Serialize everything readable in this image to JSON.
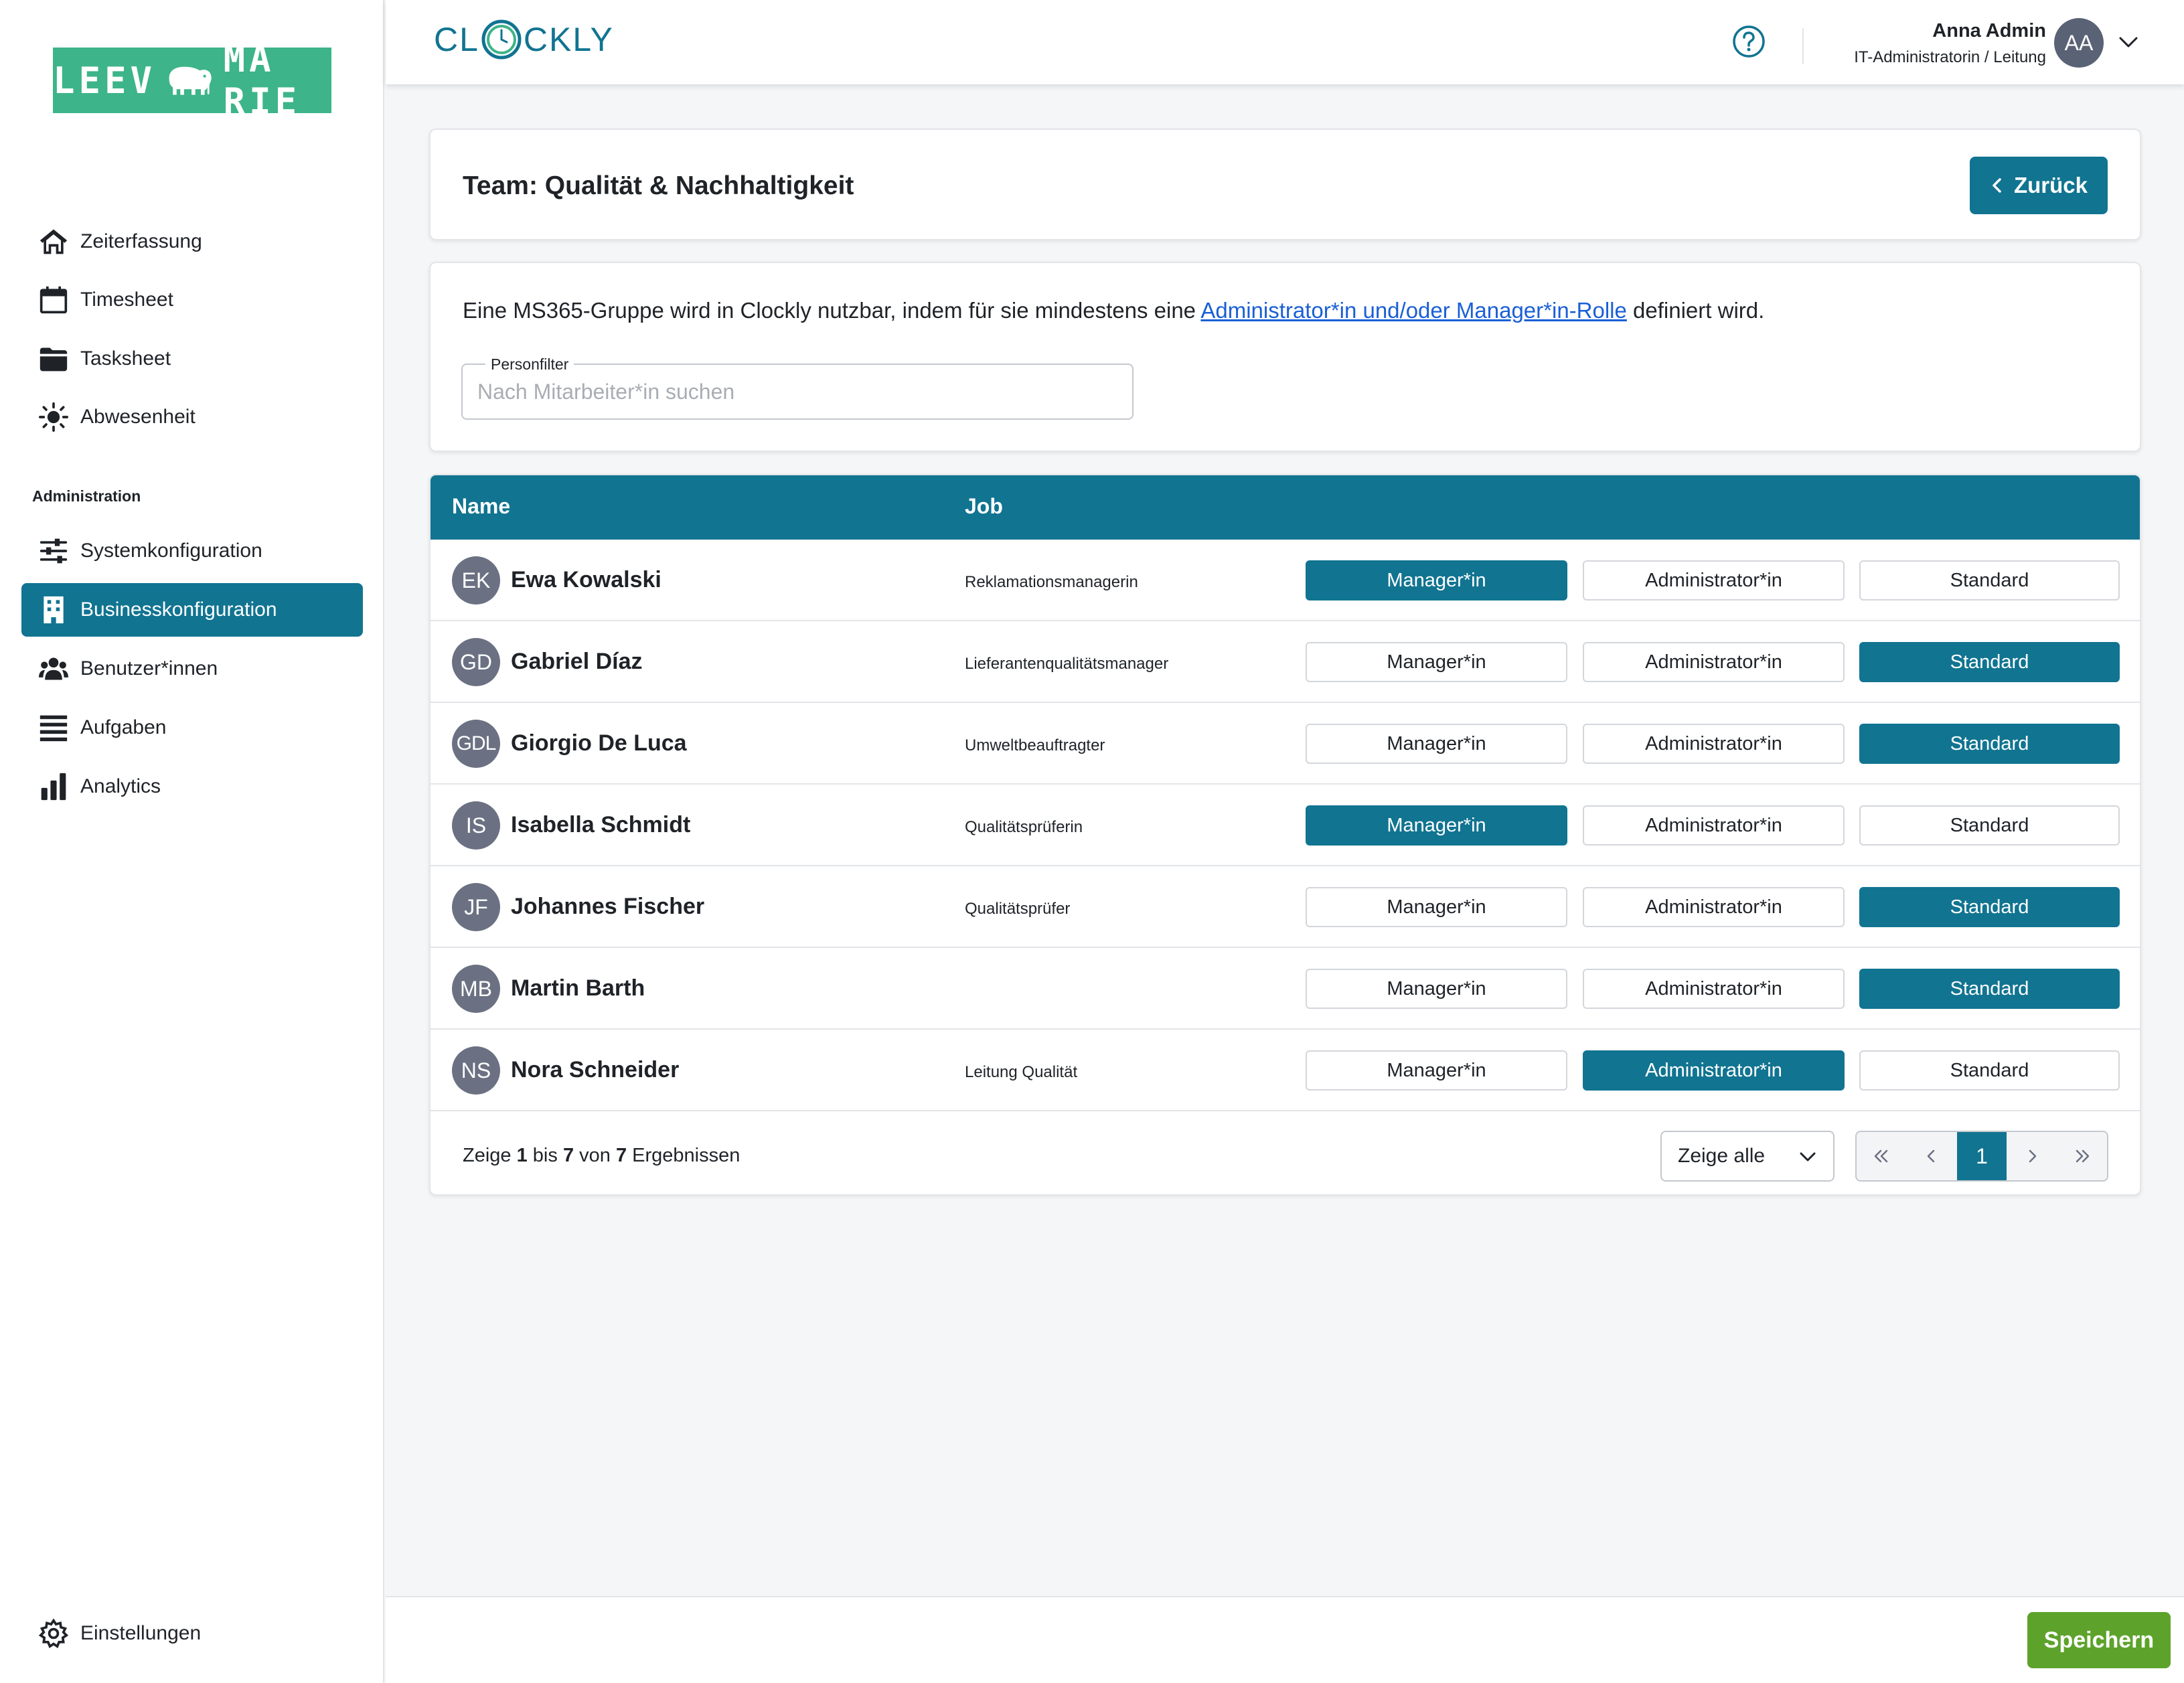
{
  "sidebar": {
    "logo_left": "LEEV",
    "logo_right": "MA RIE",
    "items": [
      {
        "label": "Zeiterfassung",
        "icon": "home-icon"
      },
      {
        "label": "Timesheet",
        "icon": "calendar-icon"
      },
      {
        "label": "Tasksheet",
        "icon": "folder-icon"
      },
      {
        "label": "Abwesenheit",
        "icon": "sun-icon"
      }
    ],
    "section_label": "Administration",
    "admin_items": [
      {
        "label": "Systemkonfiguration",
        "icon": "sliders-icon"
      },
      {
        "label": "Businesskonfiguration",
        "icon": "building-icon",
        "active": true
      },
      {
        "label": "Benutzer*innen",
        "icon": "users-icon"
      },
      {
        "label": "Aufgaben",
        "icon": "list-icon"
      },
      {
        "label": "Analytics",
        "icon": "bar-chart-icon"
      }
    ],
    "settings_label": "Einstellungen"
  },
  "header": {
    "logo_left": "CL",
    "logo_right": "CKLY",
    "user_name": "Anna Admin",
    "user_role": "IT-Administratorin / Leitung",
    "user_initials": "AA"
  },
  "page": {
    "title": "Team: Qualität & Nachhaltigkeit",
    "back_label": "Zurück",
    "info_before": "Eine MS365-Gruppe wird in Clockly nutzbar, indem für sie mindestens eine ",
    "info_link": "Administrator*in und/oder Manager*in-Rolle",
    "info_after": " definiert wird.",
    "filter_label": "Personfilter",
    "filter_placeholder": "Nach Mitarbeiter*in suchen",
    "filter_value": ""
  },
  "table": {
    "col_name": "Name",
    "col_job": "Job",
    "role_labels": [
      "Manager*in",
      "Administrator*in",
      "Standard"
    ],
    "rows": [
      {
        "initials": "EK",
        "name": "Ewa Kowalski",
        "job": "Reklamationsmanagerin",
        "role": "Manager*in"
      },
      {
        "initials": "GD",
        "name": "Gabriel Díaz",
        "job": "Lieferantenqualitätsmanager",
        "role": "Standard"
      },
      {
        "initials": "GDL",
        "name": "Giorgio De Luca",
        "job": "Umweltbeauftragter",
        "role": "Standard"
      },
      {
        "initials": "IS",
        "name": "Isabella Schmidt",
        "job": "Qualitätsprüferin",
        "role": "Manager*in"
      },
      {
        "initials": "JF",
        "name": "Johannes Fischer",
        "job": "Qualitätsprüfer",
        "role": "Standard"
      },
      {
        "initials": "MB",
        "name": "Martin Barth",
        "job": "",
        "role": "Standard"
      },
      {
        "initials": "NS",
        "name": "Nora Schneider",
        "job": "Leitung Qualität",
        "role": "Administrator*in"
      }
    ],
    "results_prefix": "Zeige ",
    "results_from": "1",
    "results_mid1": " bis ",
    "results_to": "7",
    "results_mid2": " von ",
    "results_total": "7",
    "results_suffix": " Ergebnissen",
    "page_size": "Zeige alle",
    "current_page": "1"
  },
  "footer": {
    "save_label": "Speichern"
  },
  "colors": {
    "primary": "#117491",
    "save": "#5da32b",
    "brand_green": "#3db489",
    "link": "#1a5fd6"
  }
}
